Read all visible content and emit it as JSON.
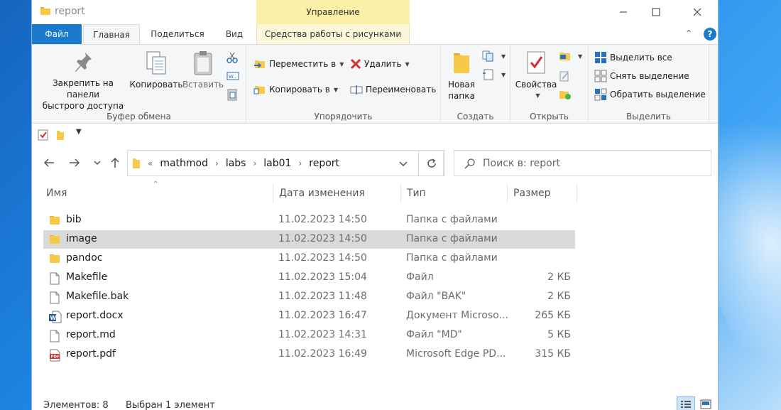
{
  "window": {
    "title": "report"
  },
  "contextual_tab": {
    "label": "Управление"
  },
  "tabs": {
    "file": "Файл",
    "home": "Главная",
    "share": "Поделиться",
    "view": "Вид",
    "picture_tools": "Средства работы с рисунками"
  },
  "ribbon": {
    "clipboard": {
      "label": "Буфер обмена",
      "pin_line1": "Закрепить на панели",
      "pin_line2": "быстрого доступа",
      "copy": "Копировать",
      "paste": "Вставить"
    },
    "organize": {
      "label": "Упорядочить",
      "move_to": "Переместить в",
      "copy_to": "Копировать в",
      "delete": "Удалить",
      "rename": "Переименовать"
    },
    "new": {
      "label": "Создать",
      "new_folder_line1": "Новая",
      "new_folder_line2": "папка"
    },
    "open": {
      "label": "Открыть",
      "properties": "Свойства"
    },
    "select": {
      "label": "Выделить",
      "select_all": "Выделить все",
      "select_none": "Снять выделение",
      "invert": "Обратить выделение"
    }
  },
  "address": {
    "overflow": "«",
    "crumbs": [
      "mathmod",
      "labs",
      "lab01",
      "report"
    ]
  },
  "search": {
    "placeholder": "Поиск в: report"
  },
  "columns": {
    "name": "Имя",
    "date": "Дата изменения",
    "type": "Тип",
    "size": "Размер"
  },
  "files": [
    {
      "name": "bib",
      "date": "11.02.2023 14:50",
      "type": "Папка с файлами",
      "size": "",
      "icon": "folder-icon"
    },
    {
      "name": "image",
      "date": "11.02.2023 14:50",
      "type": "Папка с файлами",
      "size": "",
      "icon": "folder-icon",
      "selected": true
    },
    {
      "name": "pandoc",
      "date": "11.02.2023 14:50",
      "type": "Папка с файлами",
      "size": "",
      "icon": "folder-icon"
    },
    {
      "name": "Makefile",
      "date": "11.02.2023 15:04",
      "type": "Файл",
      "size": "2 КБ",
      "icon": "file-icon"
    },
    {
      "name": "Makefile.bak",
      "date": "11.02.2023 11:48",
      "type": "Файл \"BAK\"",
      "size": "2 КБ",
      "icon": "file-icon"
    },
    {
      "name": "report.docx",
      "date": "11.02.2023 16:47",
      "type": "Документ Microso...",
      "size": "265 КБ",
      "icon": "word-document-icon"
    },
    {
      "name": "report.md",
      "date": "11.02.2023 14:31",
      "type": "Файл \"MD\"",
      "size": "5 КБ",
      "icon": "file-icon"
    },
    {
      "name": "report.pdf",
      "date": "11.02.2023 16:49",
      "type": "Microsoft Edge PD...",
      "size": "315 КБ",
      "icon": "pdf-icon"
    }
  ],
  "status": {
    "count": "Элементов: 8",
    "selected": "Выбран 1 элемент"
  },
  "colors": {
    "file_tab": "#1979ca",
    "contextual_tab": "#fbf0a8",
    "selection": "#d9d9d9",
    "folder": "#f7c948"
  }
}
